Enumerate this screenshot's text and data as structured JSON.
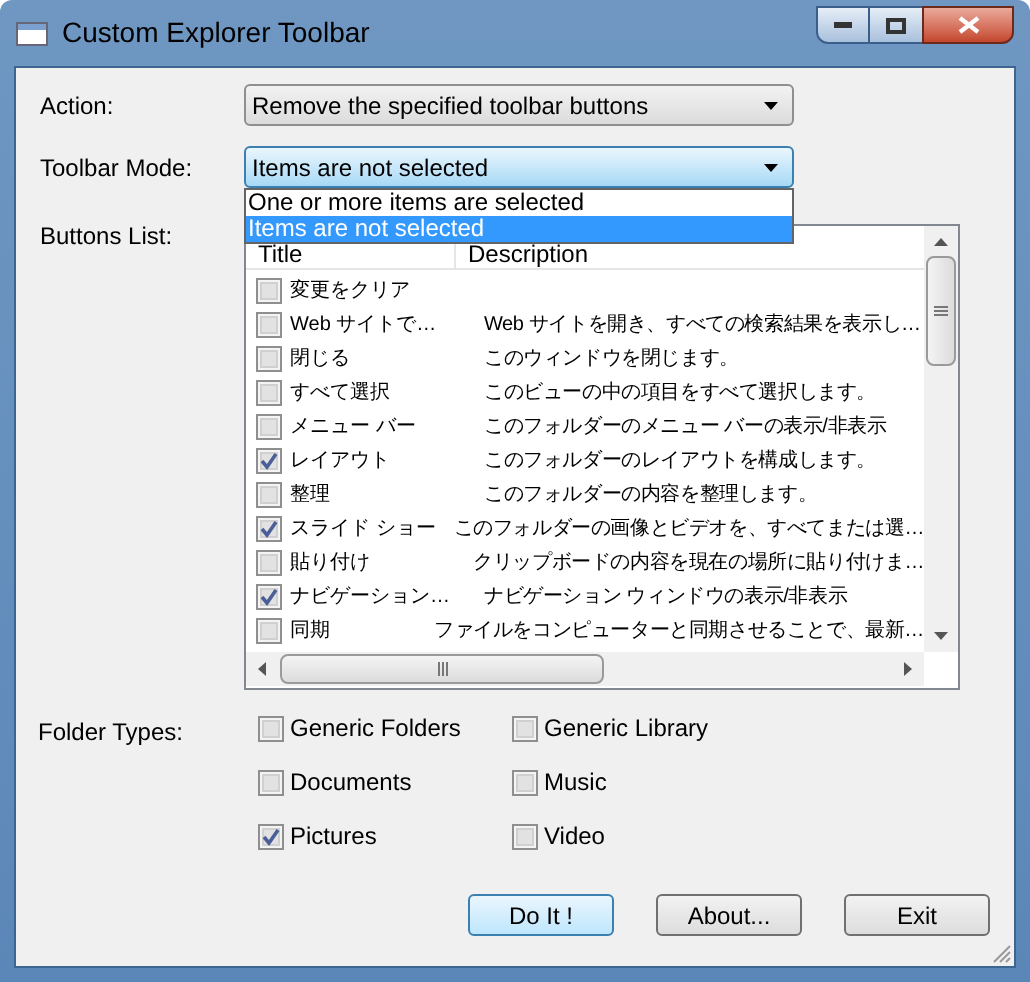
{
  "window": {
    "title": "Custom Explorer Toolbar"
  },
  "action": {
    "label": "Action:",
    "value": "Remove the specified toolbar buttons"
  },
  "toolbar_mode": {
    "label": "Toolbar Mode:",
    "value": "Items are not selected",
    "expanded": true,
    "options": [
      {
        "label": "One or more items are selected",
        "selected": false
      },
      {
        "label": "Items are not selected",
        "selected": true
      }
    ]
  },
  "buttons_list": {
    "label": "Buttons List:",
    "columns": [
      "Title",
      "Description"
    ],
    "rows": [
      {
        "title": "変更をクリア",
        "checked": false
      },
      {
        "title": "Web サイトで…",
        "description": "Web サイトを開き、すべての検索結果を表示し…",
        "checked": false
      },
      {
        "title": "閉じる",
        "description": "このウィンドウを閉じます。",
        "checked": false
      },
      {
        "title": "すべて選択",
        "description": "このビューの中の項目をすべて選択します。",
        "checked": false
      },
      {
        "title": "メニュー バー",
        "description": "このフォルダーのメニュー バーの表示/非表示",
        "checked": false
      },
      {
        "title": "レイアウト",
        "description": "このフォルダーのレイアウトを構成します。",
        "checked": true
      },
      {
        "title": "整理",
        "description": "このフォルダーの内容を整理します。",
        "checked": false
      },
      {
        "title": "スライド ショー",
        "description": "このフォルダーの画像とビデオを、すべてまたは選…",
        "checked": true
      },
      {
        "title": "貼り付け",
        "description": "クリップボードの内容を現在の場所に貼り付けま…",
        "checked": false
      },
      {
        "title": "ナビゲーション…",
        "description": "ナビゲーション ウィンドウの表示/非表示",
        "checked": true
      },
      {
        "title": "同期",
        "description": "ファイルをコンピューターと同期させることで、最新…",
        "checked": false
      }
    ]
  },
  "folder_types": {
    "label": "Folder Types:",
    "items": [
      {
        "label": "Generic Folders",
        "checked": false
      },
      {
        "label": "Generic Library",
        "checked": false
      },
      {
        "label": "Documents",
        "checked": false
      },
      {
        "label": "Music",
        "checked": false
      },
      {
        "label": "Pictures",
        "checked": true
      },
      {
        "label": "Video",
        "checked": false
      }
    ]
  },
  "buttons": [
    {
      "label": "Do It !",
      "default": true
    },
    {
      "label": "About...",
      "default": false
    },
    {
      "label": "Exit",
      "default": false
    }
  ]
}
